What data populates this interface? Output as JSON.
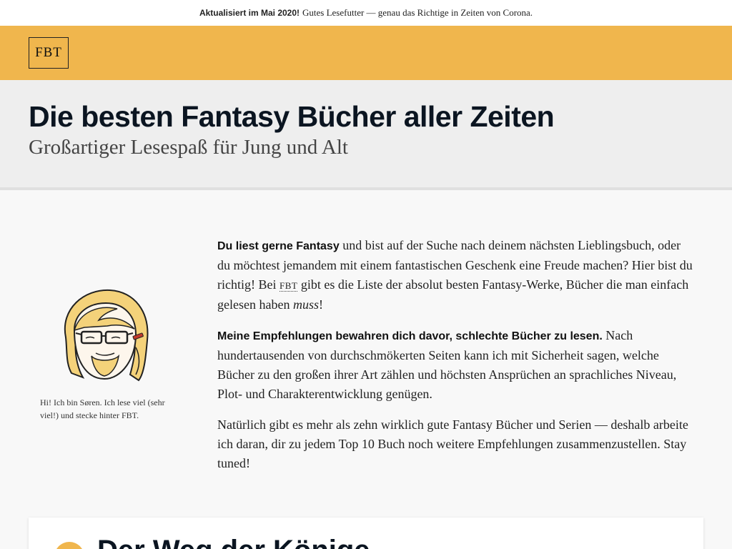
{
  "announcement": {
    "highlight": "Aktualisiert im Mai 2020!",
    "text": "Gutes Lesefutter — genau das Richtige in Zeiten von Corona."
  },
  "brand": {
    "logo_text": "FBT"
  },
  "hero": {
    "title": "Die besten Fantasy Bücher aller Zeiten",
    "subtitle": "Großartiger Lesespaß für Jung und Alt"
  },
  "author": {
    "caption": "Hi! Ich bin Søren. Ich lese viel (sehr viel!) und stecke hinter FBT."
  },
  "intro": {
    "p1_lead": "Du liest gerne Fantasy",
    "p1_a": " und bist auf der Suche nach deinem nächsten Lieblingsbuch, oder du möchtest jemandem mit einem fantastischen Geschenk eine Freude machen? Hier bist du richtig! Bei ",
    "p1_fbt": "FBT",
    "p1_b": " gibt es die Liste der absolut besten Fantasy-Werke, Bücher die man einfach gelesen haben ",
    "p1_em": "muss",
    "p1_end": "!",
    "p2_lead": "Meine Empfehlungen bewahren dich davor, schlechte Bücher zu lesen.",
    "p2_text": " Nach hundertausenden von durchschmökerten Seiten kann ich mit Sicherheit sagen, welche Bücher zu den großen ihrer Art zählen und höchsten Ansprüchen an sprachliches Niveau, Plot- und Charakterentwicklung genügen.",
    "p3": "Natürlich gibt es mehr als zehn wirklich gute Fantasy Bücher und Serien — deshalb arbeite ich daran, dir zu jedem Top 10 Buch noch weitere Empfehlungen zusammenzustellen. Stay tuned!"
  },
  "card": {
    "title": "Der Weg der Könige"
  },
  "colors": {
    "accent": "#f0b64d",
    "heading": "#0b1521"
  },
  "icons": {
    "avatar": "author-avatar-illustration"
  }
}
